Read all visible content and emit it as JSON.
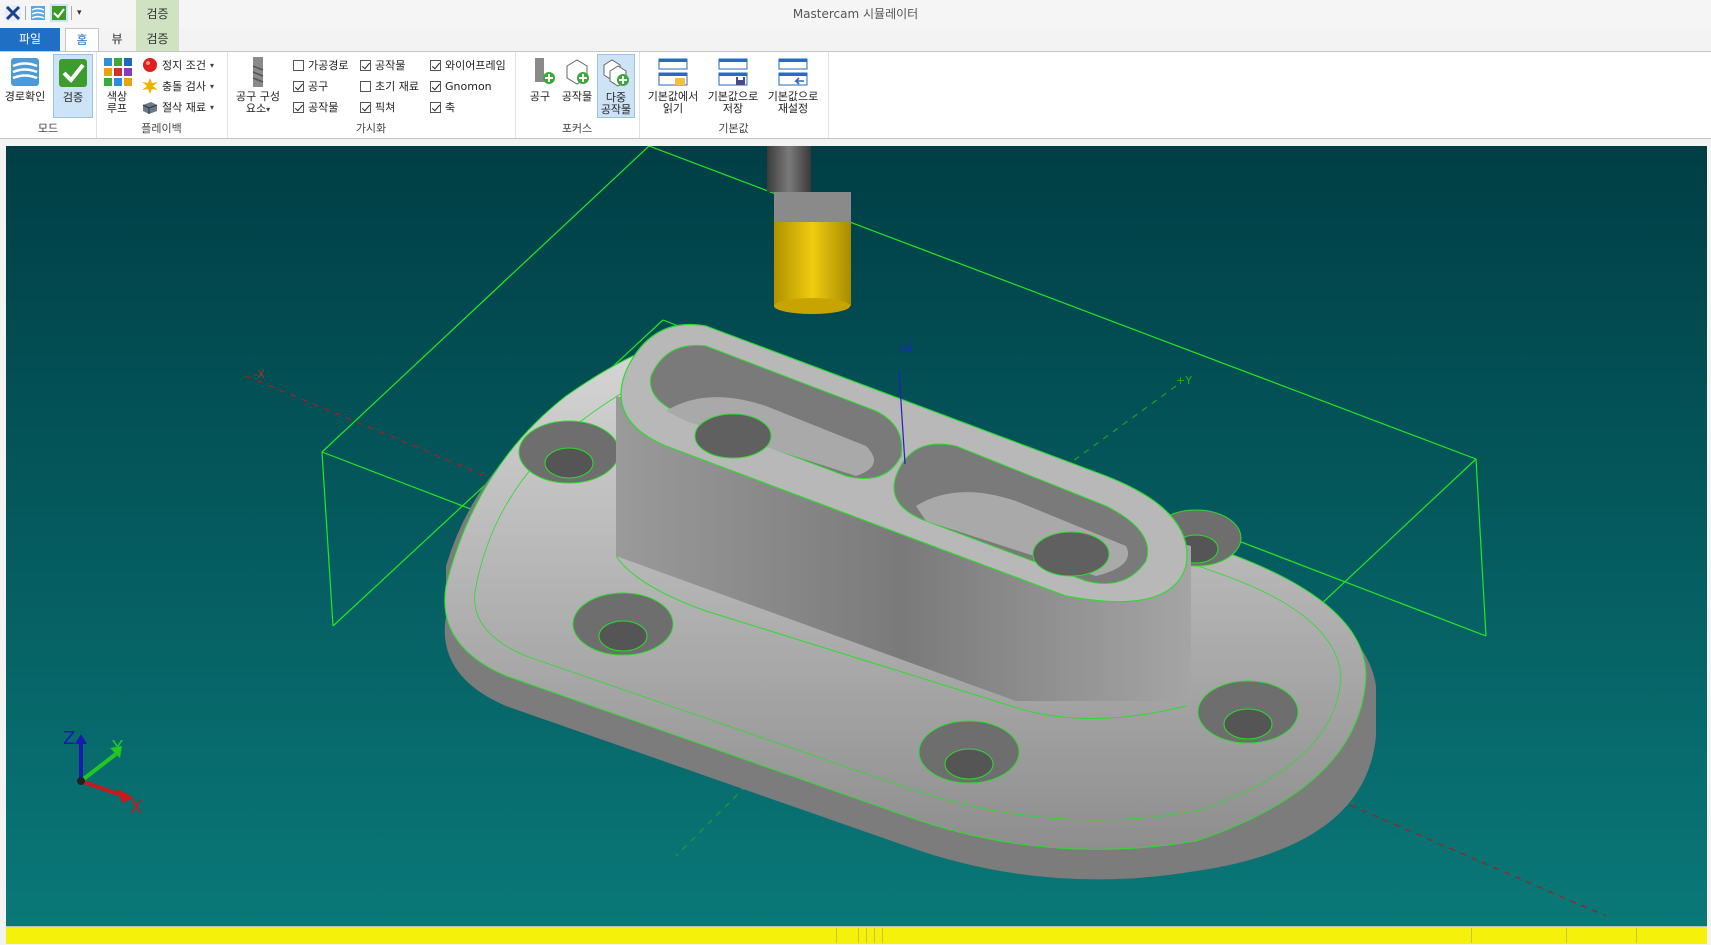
{
  "app": {
    "title": "Mastercam 시뮬레이터"
  },
  "context_tab": {
    "title": "검증"
  },
  "tabs": [
    {
      "label": "파일"
    },
    {
      "label": "홈"
    },
    {
      "label": "뷰"
    },
    {
      "label": "검증"
    }
  ],
  "ribbon": {
    "mode": {
      "label": "모드",
      "path_check": "경로확인",
      "verify": "검증"
    },
    "playback": {
      "label": "플레이백",
      "color_loop_line1": "색상",
      "color_loop_line2": "루프",
      "stop_condition": "정지 조건",
      "collision_check": "충돌 검사",
      "cut_stock": "절삭 재료"
    },
    "visualize": {
      "label": "가시화",
      "tool_components_line1": "공구 구성",
      "tool_components_line2": "요소",
      "checkboxes": [
        {
          "label": "가공경로",
          "checked": false
        },
        {
          "label": "공구",
          "checked": true
        },
        {
          "label": "공작물",
          "checked": true
        },
        {
          "label": "공작물",
          "checked": true
        },
        {
          "label": "초기 재료",
          "checked": false
        },
        {
          "label": "픽쳐",
          "checked": true
        },
        {
          "label": "와이어프레임",
          "checked": true
        },
        {
          "label": "Gnomon",
          "checked": true
        },
        {
          "label": "축",
          "checked": true
        }
      ]
    },
    "focus": {
      "label": "포커스",
      "tool": "공구",
      "workpiece": "공작물",
      "multi_line1": "다중",
      "multi_line2": "공작물"
    },
    "defaults": {
      "label": "기본값",
      "load_line1": "기본값에서",
      "load_line2": "읽기",
      "save_line1": "기본값으로",
      "save_line2": "저장",
      "reset_line1": "기본값으로",
      "reset_line2": "재설정"
    }
  },
  "viewport": {
    "axis_labels": {
      "x_neg": "-X",
      "y_pos": "+Y",
      "z_pos": "+Z"
    },
    "gnomon": {
      "x": "X",
      "y": "Y",
      "z": "Z"
    },
    "colors": {
      "wireframe": "#22e822",
      "tool_holder": "#d9b400",
      "part": "#a8a8a8"
    }
  }
}
